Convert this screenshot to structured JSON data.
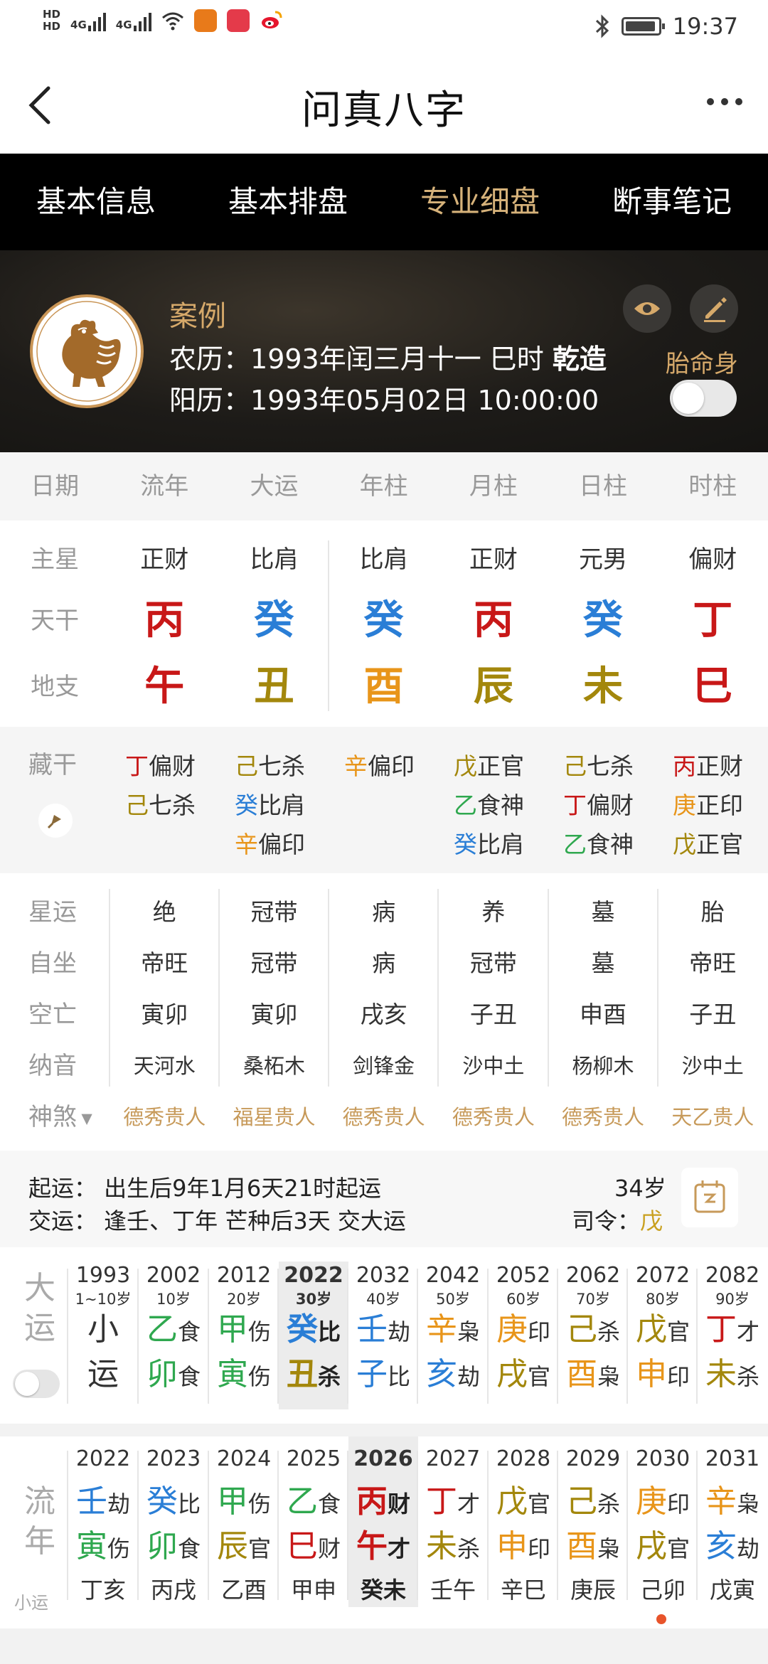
{
  "status": {
    "time": "19:37",
    "hd1": "HD",
    "hd2": "HD",
    "net1": "4G",
    "net2": "4G"
  },
  "header": {
    "title": "问真八字"
  },
  "tabs": [
    {
      "label": "基本信息"
    },
    {
      "label": "基本排盘"
    },
    {
      "label": "专业细盘",
      "active": true
    },
    {
      "label": "断事笔记"
    }
  ],
  "profile": {
    "name": "案例",
    "lunar_label": "农历：",
    "lunar": "1993年闰三月十一 巳时",
    "gender": "乾造",
    "solar_label": "阳历：",
    "solar": "1993年05月02日 10:00:00",
    "taiming": "胎命身",
    "accent": "#d6a96a"
  },
  "chart": {
    "headers": [
      "日期",
      "流年",
      "大运",
      "年柱",
      "月柱",
      "日柱",
      "时柱"
    ],
    "zhuxing": {
      "label": "主星",
      "values": [
        "正财",
        "比肩",
        "比肩",
        "正财",
        "元男",
        "偏财"
      ]
    },
    "tiangan": {
      "label": "天干",
      "values": [
        "丙",
        "癸",
        "癸",
        "丙",
        "癸",
        "丁"
      ],
      "colors": [
        "red",
        "blue",
        "blue",
        "red",
        "blue",
        "red"
      ]
    },
    "dizhi": {
      "label": "地支",
      "values": [
        "午",
        "丑",
        "酉",
        "辰",
        "未",
        "巳"
      ],
      "colors": [
        "red",
        "olive",
        "orange",
        "olive",
        "olive",
        "red"
      ]
    },
    "canggan_label": "藏干",
    "canggan": [
      [
        {
          "g": "丁",
          "c": "red",
          "s": "偏财"
        },
        {
          "g": "己",
          "c": "olive",
          "s": "七杀"
        }
      ],
      [
        {
          "g": "己",
          "c": "olive",
          "s": "七杀"
        },
        {
          "g": "癸",
          "c": "blue",
          "s": "比肩"
        },
        {
          "g": "辛",
          "c": "orange",
          "s": "偏印"
        }
      ],
      [
        {
          "g": "辛",
          "c": "orange",
          "s": "偏印"
        }
      ],
      [
        {
          "g": "戊",
          "c": "olive",
          "s": "正官"
        },
        {
          "g": "乙",
          "c": "green",
          "s": "食神"
        },
        {
          "g": "癸",
          "c": "blue",
          "s": "比肩"
        }
      ],
      [
        {
          "g": "己",
          "c": "olive",
          "s": "七杀"
        },
        {
          "g": "丁",
          "c": "red",
          "s": "偏财"
        },
        {
          "g": "乙",
          "c": "green",
          "s": "食神"
        }
      ],
      [
        {
          "g": "丙",
          "c": "red",
          "s": "正财"
        },
        {
          "g": "庚",
          "c": "orange",
          "s": "正印"
        },
        {
          "g": "戊",
          "c": "olive",
          "s": "正官"
        }
      ]
    ],
    "xingyun": {
      "label": "星运",
      "values": [
        "绝",
        "冠带",
        "病",
        "养",
        "墓",
        "胎"
      ]
    },
    "zizuo": {
      "label": "自坐",
      "values": [
        "帝旺",
        "冠带",
        "病",
        "冠带",
        "墓",
        "帝旺"
      ]
    },
    "kongwang": {
      "label": "空亡",
      "values": [
        "寅卯",
        "寅卯",
        "戌亥",
        "子丑",
        "申酉",
        "子丑"
      ]
    },
    "nayin": {
      "label": "纳音",
      "values": [
        "天河水",
        "桑柘木",
        "剑锋金",
        "沙中土",
        "杨柳木",
        "沙中土"
      ]
    },
    "shensha": {
      "label": "神煞",
      "values": [
        "德秀贵人",
        "福星贵人",
        "德秀贵人",
        "德秀贵人",
        "德秀贵人",
        "天乙贵人"
      ]
    }
  },
  "qiyun": {
    "line1": "起运：  出生后9年1月6天21时起运",
    "line2": "交运：  逢壬、丁年 芒种后3天 交大运",
    "age": "34岁",
    "siling_label": "司令：",
    "siling": "戊"
  },
  "dayun": {
    "label_top": "大",
    "label_bottom": "运",
    "columns": [
      {
        "year": "1993",
        "age": "1~10岁",
        "g": "小",
        "gc": "",
        "gs": "",
        "z": "运",
        "zc": "",
        "zs": ""
      },
      {
        "year": "2002",
        "age": "10岁",
        "g": "乙",
        "gc": "green",
        "gs": "食",
        "z": "卯",
        "zc": "green",
        "zs": "食"
      },
      {
        "year": "2012",
        "age": "20岁",
        "g": "甲",
        "gc": "green",
        "gs": "伤",
        "z": "寅",
        "zc": "green",
        "zs": "伤"
      },
      {
        "year": "2022",
        "age": "30岁",
        "g": "癸",
        "gc": "blue",
        "gs": "比",
        "z": "丑",
        "zc": "olive",
        "zs": "杀",
        "selected": true
      },
      {
        "year": "2032",
        "age": "40岁",
        "g": "壬",
        "gc": "blue",
        "gs": "劫",
        "z": "子",
        "zc": "blue",
        "zs": "比"
      },
      {
        "year": "2042",
        "age": "50岁",
        "g": "辛",
        "gc": "orange",
        "gs": "枭",
        "z": "亥",
        "zc": "blue",
        "zs": "劫"
      },
      {
        "year": "2052",
        "age": "60岁",
        "g": "庚",
        "gc": "orange",
        "gs": "印",
        "z": "戌",
        "zc": "olive",
        "zs": "官"
      },
      {
        "year": "2062",
        "age": "70岁",
        "g": "己",
        "gc": "olive",
        "gs": "杀",
        "z": "酉",
        "zc": "orange",
        "zs": "枭"
      },
      {
        "year": "2072",
        "age": "80岁",
        "g": "戊",
        "gc": "olive",
        "gs": "官",
        "z": "申",
        "zc": "orange",
        "zs": "印"
      },
      {
        "year": "2082",
        "age": "90岁",
        "g": "丁",
        "gc": "red",
        "gs": "才",
        "z": "未",
        "zc": "olive",
        "zs": "杀"
      }
    ]
  },
  "liunian": {
    "label_top": "流",
    "label_bottom": "年",
    "sub": "小运",
    "columns": [
      {
        "year": "2022",
        "g": "壬",
        "gc": "blue",
        "gs": "劫",
        "z": "寅",
        "zc": "green",
        "zs": "伤",
        "x": "丁亥"
      },
      {
        "year": "2023",
        "g": "癸",
        "gc": "blue",
        "gs": "比",
        "z": "卯",
        "zc": "green",
        "zs": "食",
        "x": "丙戌"
      },
      {
        "year": "2024",
        "g": "甲",
        "gc": "green",
        "gs": "伤",
        "z": "辰",
        "zc": "olive",
        "zs": "官",
        "x": "乙酉"
      },
      {
        "year": "2025",
        "g": "乙",
        "gc": "green",
        "gs": "食",
        "z": "巳",
        "zc": "red",
        "zs": "财",
        "x": "甲申"
      },
      {
        "year": "2026",
        "g": "丙",
        "gc": "red",
        "gs": "财",
        "z": "午",
        "zc": "red",
        "zs": "才",
        "x": "癸未",
        "selected": true
      },
      {
        "year": "2027",
        "g": "丁",
        "gc": "red",
        "gs": "才",
        "z": "未",
        "zc": "olive",
        "zs": "杀",
        "x": "壬午"
      },
      {
        "year": "2028",
        "g": "戊",
        "gc": "olive",
        "gs": "官",
        "z": "申",
        "zc": "orange",
        "zs": "印",
        "x": "辛巳"
      },
      {
        "year": "2029",
        "g": "己",
        "gc": "olive",
        "gs": "杀",
        "z": "酉",
        "zc": "orange",
        "zs": "枭",
        "x": "庚辰"
      },
      {
        "year": "2030",
        "g": "庚",
        "gc": "orange",
        "gs": "印",
        "z": "戌",
        "zc": "olive",
        "zs": "官",
        "x": "己卯",
        "dot": true
      },
      {
        "year": "2031",
        "g": "辛",
        "gc": "orange",
        "gs": "枭",
        "z": "亥",
        "zc": "blue",
        "zs": "劫",
        "x": "戊寅"
      }
    ]
  }
}
